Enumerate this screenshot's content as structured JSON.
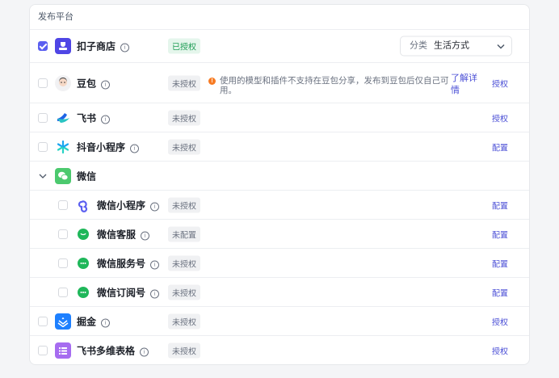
{
  "panel": {
    "title": "发布平台"
  },
  "platforms": [
    {
      "name": "扣子商店",
      "status": "已授权",
      "checked": true,
      "category_label": "分类",
      "category_value": "生活方式"
    },
    {
      "name": "豆包",
      "status": "未授权",
      "warning": "使用的模型和插件不支持在豆包分享，发布到豆包后仅自己可用。",
      "detail_link": "了解详情",
      "action": "授权"
    },
    {
      "name": "飞书",
      "status": "未授权",
      "action": "授权"
    },
    {
      "name": "抖音小程序",
      "status": "未授权",
      "action": "配置"
    },
    {
      "name": "微信",
      "expanded": true
    },
    {
      "name": "微信小程序",
      "status": "未授权",
      "action": "配置"
    },
    {
      "name": "微信客服",
      "status": "未配置",
      "action": "配置"
    },
    {
      "name": "微信服务号",
      "status": "未授权",
      "action": "配置"
    },
    {
      "name": "微信订阅号",
      "status": "未授权",
      "action": "配置"
    },
    {
      "name": "掘金",
      "status": "未授权",
      "action": "授权"
    },
    {
      "name": "飞书多维表格",
      "status": "未授权",
      "action": "授权"
    }
  ],
  "colors": {
    "accent": "#5b5ff0",
    "link": "#4b4fd6",
    "authorized_badge": "#1f9d55",
    "warning": "#f77b23"
  },
  "icons": {
    "info": "info-icon",
    "warning": "warning-icon",
    "dropdown": "chevron-down-icon",
    "collapse": "chevron-down-icon"
  }
}
